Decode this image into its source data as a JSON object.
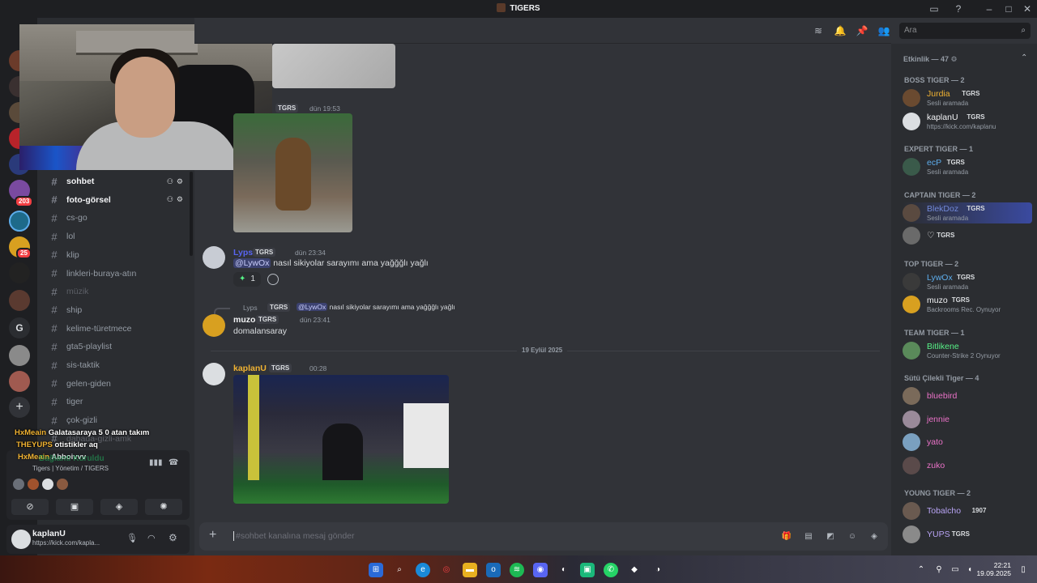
{
  "window": {
    "title": "TIGERS"
  },
  "rail": {
    "badge1": "203",
    "badge2": "25",
    "letter": "G",
    "add": "+"
  },
  "channels": [
    {
      "name": "sohbet",
      "state": "active"
    },
    {
      "name": "foto-görsel",
      "state": "active"
    },
    {
      "name": "cs-go",
      "state": "normal"
    },
    {
      "name": "lol",
      "state": "normal"
    },
    {
      "name": "klip",
      "state": "normal"
    },
    {
      "name": "linkleri-buraya-atın",
      "state": "normal"
    },
    {
      "name": "müzik",
      "state": "muted"
    },
    {
      "name": "ship",
      "state": "normal"
    },
    {
      "name": "kelime-türetmece",
      "state": "normal"
    },
    {
      "name": "gta5-playlist",
      "state": "normal"
    },
    {
      "name": "sis-taktik",
      "state": "normal"
    },
    {
      "name": "gelen-giden",
      "state": "normal"
    },
    {
      "name": "tiger",
      "state": "normal"
    },
    {
      "name": "çok-gizli",
      "state": "normal"
    },
    {
      "name": "dabada-gizli-amk",
      "state": "muted"
    }
  ],
  "overlay_chat": [
    {
      "user": "HxMeain",
      "text": "Galatasaraya 5 0 atan takım"
    },
    {
      "user": "THEYUPS",
      "text": "otistikler aq"
    },
    {
      "user": "HxMeain",
      "text": "Abboivvv"
    }
  ],
  "voice": {
    "status": "Bağlantı Kuruldu",
    "channel": "Tigers | Yönetim / TIGERS"
  },
  "user": {
    "name": "kaplanU",
    "status": "https://kick.com/kapla..."
  },
  "header": {
    "search_placeholder": "Ara"
  },
  "messages": {
    "m1": {
      "tag": "TGRS",
      "time": "dün 19:53"
    },
    "m2": {
      "user": "Lyps",
      "tag": "TGRS",
      "time": "dün 23:34",
      "mention": "@LywOx",
      "text": "nasıl sikiyolar sarayımı ama yağğğlı yağlı",
      "reaction_count": "1"
    },
    "m3": {
      "reply_user": "Lyps",
      "reply_tag": "TGRS",
      "reply_mention": "@LywOx",
      "reply_text": "nasıl sikiyolar sarayımı ama yağğğlı yağlı",
      "user": "muzo",
      "tag": "TGRS",
      "time": "dün 23:41",
      "text": "domalansaray"
    },
    "divider": "19 Eylül 2025",
    "m4": {
      "user": "kaplanU",
      "tag": "TGRS",
      "time": "00:28"
    }
  },
  "composer": {
    "placeholder": "#sohbet kanalına mesaj gönder"
  },
  "members": {
    "activity": "Etkinlik — 47",
    "groups": [
      {
        "label": "BOSS TIGER — 2",
        "members": [
          {
            "name": "Jurdia",
            "tag": "TGRS",
            "status": "Sesli aramada",
            "color": "#f0b232"
          },
          {
            "name": "kaplanU",
            "tag": "TGRS",
            "status": "https://kick.com/kaplanu",
            "color": "#f2f3f5"
          }
        ]
      },
      {
        "label": "EXPERT TIGER — 1",
        "members": [
          {
            "name": "ecP",
            "tag": "TGRS",
            "status": "Sesli aramada",
            "color": "#5dadec"
          }
        ]
      },
      {
        "label": "CAPTAIN TIGER — 2",
        "members": [
          {
            "name": "BlekDoz",
            "tag": "TGRS",
            "status": "Sesli aramada",
            "color": "#7289da"
          },
          {
            "name": "♡",
            "tag": "TGRS",
            "status": "",
            "color": "#f2f3f5"
          }
        ]
      },
      {
        "label": "TOP TIGER — 2",
        "members": [
          {
            "name": "LywOx",
            "tag": "TGRS",
            "status": "Sesli aramada",
            "color": "#5dadec"
          },
          {
            "name": "muzo",
            "tag": "TGRS",
            "status": "Backrooms Rec. Oynuyor",
            "color": "#f2f3f5"
          }
        ]
      },
      {
        "label": "TEAM TIGER — 1",
        "members": [
          {
            "name": "Bitlikene",
            "tag": "",
            "status": "Counter-Strike 2 Oynuyor",
            "color": "#57f287"
          }
        ]
      },
      {
        "label": "Sütü Çilekli Tiger — 4",
        "members": [
          {
            "name": "bluebird",
            "tag": "",
            "status": "",
            "color": "#eb72c8"
          },
          {
            "name": "jennie",
            "tag": "",
            "status": "",
            "color": "#eb72c8"
          },
          {
            "name": "yato",
            "tag": "",
            "status": "",
            "color": "#eb72c8"
          },
          {
            "name": "zuko",
            "tag": "",
            "status": "",
            "color": "#eb72c8"
          }
        ]
      },
      {
        "label": "YOUNG TIGER — 2",
        "members": [
          {
            "name": "Tobalcho",
            "tag": "1907",
            "status": "",
            "color": "#b9a4f5"
          },
          {
            "name": "YUPS",
            "tag": "TGRS",
            "status": "",
            "color": "#b9a4f5"
          }
        ]
      }
    ]
  },
  "taskbar": {
    "time": "22:21",
    "date": "19.09.2025"
  },
  "colors": {
    "accent": "#5865f2",
    "bg": "#313338",
    "sidebar": "#2b2d31"
  }
}
